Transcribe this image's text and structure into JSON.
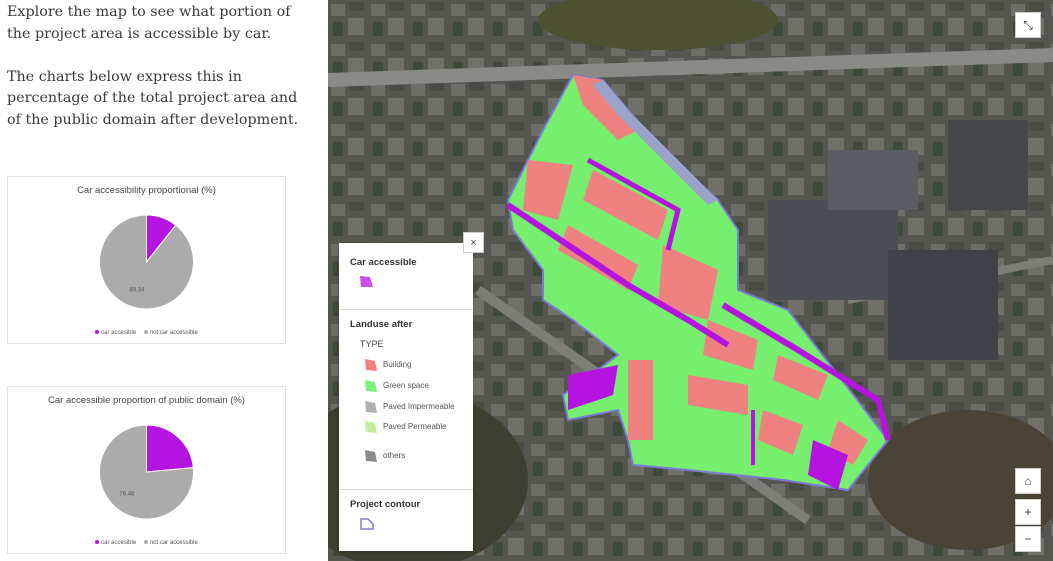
{
  "intro": {
    "paragraph1": "Explore the map to see what portion of the project area is accessible by car.",
    "paragraph2": "The charts below express this in percentage of the total project area and of the public domain after development."
  },
  "charts": [
    {
      "title": "Car accessibility proportional (%)",
      "legend": [
        "car accesible",
        "not car accessible"
      ]
    },
    {
      "title": "Car accessible proportion of public domain (%)",
      "legend": [
        "car accesible",
        "not car accessible"
      ]
    }
  ],
  "chart_data": [
    {
      "type": "pie",
      "title": "Car accessibility proportional (%)",
      "categories": [
        "car accesible",
        "not car accessible"
      ],
      "values": [
        10.66,
        89.34
      ],
      "value_labels": [
        "",
        "89,34"
      ],
      "colors": [
        "#b514e0",
        "#ababab"
      ],
      "legend_position": "bottom"
    },
    {
      "type": "pie",
      "title": "Car accessible proportion of public domain (%)",
      "categories": [
        "car accesible",
        "not car accessible"
      ],
      "values": [
        23.52,
        76.48
      ],
      "value_labels": [
        "",
        "76,48"
      ],
      "colors": [
        "#b514e0",
        "#ababab"
      ],
      "legend_position": "bottom"
    }
  ],
  "map_legend": {
    "car_accessible_title": "Car accessible",
    "landuse_title": "Landuse after",
    "type_label": "TYPE",
    "items": [
      {
        "label": "Building",
        "color": "#f47f7f"
      },
      {
        "label": "Green space",
        "color": "#7cf27c"
      },
      {
        "label": "Paved Impermeable",
        "color": "#b0b0b0"
      },
      {
        "label": "Paved Permeable",
        "color": "#c2ef9a"
      },
      {
        "label": "others",
        "color": "#8a8a8a"
      }
    ],
    "project_contour_title": "Project contour",
    "close_label": "×"
  },
  "map_controls": {
    "expand_label": "⤡",
    "home_label": "⌂",
    "zoom_in_label": "+",
    "zoom_out_label": "−"
  },
  "colors": {
    "car_accessible": "#b514e0",
    "not_car_accessible": "#ababab",
    "building": "#f47f7f",
    "green_space": "#7cf27c",
    "contour": "#7b7bd6"
  }
}
